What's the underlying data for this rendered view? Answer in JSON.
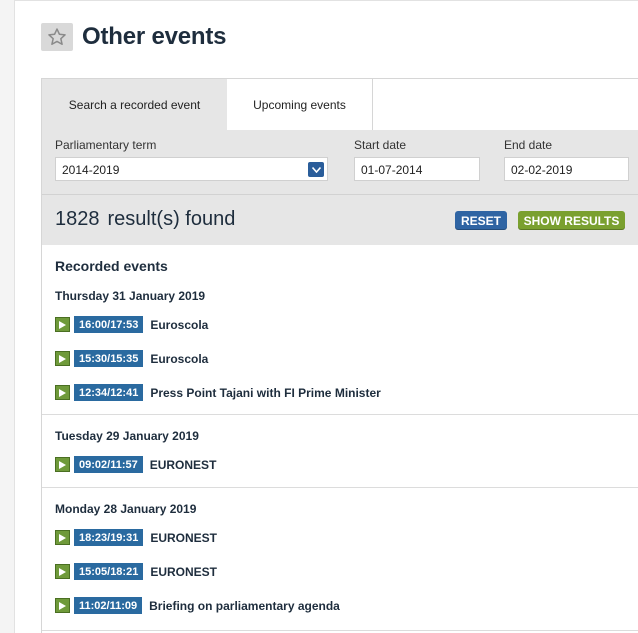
{
  "header": {
    "title": "Other events"
  },
  "tabs": [
    {
      "label": "Search a recorded event",
      "active": true
    },
    {
      "label": "Upcoming events",
      "active": false
    }
  ],
  "filters": {
    "term_label": "Parliamentary term",
    "term_value": "2014-2019",
    "start_label": "Start date",
    "start_value": "01-07-2014",
    "end_label": "End date",
    "end_value": "02-02-2019"
  },
  "results": {
    "count": "1828",
    "text": "result(s) found",
    "reset_label": "RESET",
    "show_label": "SHOW RESULTS"
  },
  "recorded": {
    "heading": "Recorded events",
    "days": [
      {
        "date": "Thursday 31 January 2019",
        "events": [
          {
            "time": "16:00/17:53",
            "name": "Euroscola"
          },
          {
            "time": "15:30/15:35",
            "name": "Euroscola"
          },
          {
            "time": "12:34/12:41",
            "name": "Press Point Tajani with FI Prime Minister"
          }
        ]
      },
      {
        "date": "Tuesday 29 January 2019",
        "events": [
          {
            "time": "09:02/11:57",
            "name": "EURONEST"
          }
        ]
      },
      {
        "date": "Monday 28 January 2019",
        "events": [
          {
            "time": "18:23/19:31",
            "name": "EURONEST"
          },
          {
            "time": "15:05/18:21",
            "name": "EURONEST"
          },
          {
            "time": "11:02/11:09",
            "name": "Briefing on parliamentary agenda"
          }
        ]
      }
    ]
  },
  "colors": {
    "accent_blue": "#2a6aa0",
    "play_green": "#6f9a3a",
    "show_green": "#7aa02f",
    "reset_blue": "#2f64a3"
  }
}
